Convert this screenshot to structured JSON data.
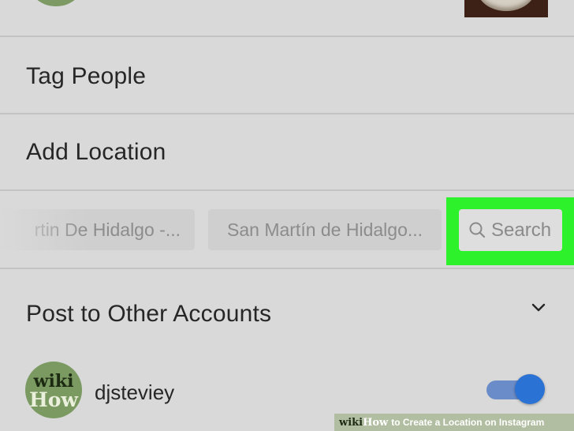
{
  "rows": {
    "tag_people": "Tag People",
    "add_location": "Add Location",
    "post_to_other_accounts": "Post to Other Accounts"
  },
  "location_suggestions": [
    "rtin De Hidalgo -...",
    "San Martín de Hidalgo..."
  ],
  "search_chip": {
    "label": "Search",
    "icon": "search-icon"
  },
  "account": {
    "name": "djsteviey",
    "avatar_text_top": "wiki",
    "avatar_text_bottom": "How",
    "share_enabled": true
  },
  "watermark": {
    "wiki": "wiki",
    "how": "How",
    "rest": "to Create a Location on Instagram"
  },
  "colors": {
    "background": "#d9d9d9",
    "highlight": "#2df22b",
    "toggle_on": "#2a72d4"
  }
}
